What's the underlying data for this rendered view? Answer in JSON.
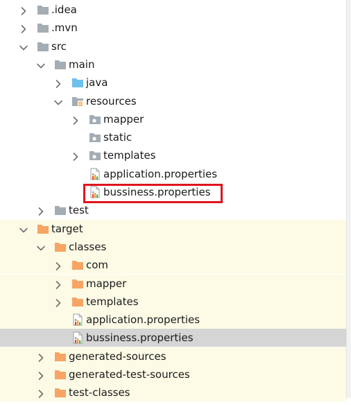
{
  "tree": {
    "nodes": [
      {
        "id": "idea",
        "label": ".idea",
        "depth": 0,
        "arrow": "right",
        "icon": "folder-gray"
      },
      {
        "id": "mvn",
        "label": ".mvn",
        "depth": 0,
        "arrow": "right",
        "icon": "folder-gray"
      },
      {
        "id": "src",
        "label": "src",
        "depth": 0,
        "arrow": "down",
        "icon": "folder-gray"
      },
      {
        "id": "main",
        "label": "main",
        "depth": 1,
        "arrow": "down",
        "icon": "folder-gray"
      },
      {
        "id": "java",
        "label": "java",
        "depth": 2,
        "arrow": "right",
        "icon": "folder-blue"
      },
      {
        "id": "resources",
        "label": "resources",
        "depth": 2,
        "arrow": "down",
        "icon": "folder-resources"
      },
      {
        "id": "mapper",
        "label": "mapper",
        "depth": 3,
        "arrow": "right",
        "icon": "folder-package"
      },
      {
        "id": "static",
        "label": "static",
        "depth": 3,
        "arrow": "none",
        "icon": "folder-package"
      },
      {
        "id": "templates",
        "label": "templates",
        "depth": 3,
        "arrow": "right",
        "icon": "folder-package"
      },
      {
        "id": "app-props-src",
        "label": "application.properties",
        "depth": 3,
        "arrow": "none",
        "icon": "properties-file"
      },
      {
        "id": "biz-props-src",
        "label": "bussiness.properties",
        "depth": 3,
        "arrow": "none",
        "icon": "properties-file"
      },
      {
        "id": "test",
        "label": "test",
        "depth": 1,
        "arrow": "right",
        "icon": "folder-gray"
      },
      {
        "id": "target",
        "label": "target",
        "depth": 0,
        "arrow": "down",
        "icon": "folder-orange",
        "excluded": true
      },
      {
        "id": "classes",
        "label": "classes",
        "depth": 1,
        "arrow": "down",
        "icon": "folder-orange",
        "excluded": true
      },
      {
        "id": "com",
        "label": "com",
        "depth": 2,
        "arrow": "right",
        "icon": "folder-orange",
        "excluded": true
      },
      {
        "id": "mapper-target",
        "label": "mapper",
        "depth": 2,
        "arrow": "right",
        "icon": "folder-orange",
        "excluded": true
      },
      {
        "id": "templates-target",
        "label": "templates",
        "depth": 2,
        "arrow": "right",
        "icon": "folder-orange",
        "excluded": true
      },
      {
        "id": "app-props-target",
        "label": "application.properties",
        "depth": 2,
        "arrow": "none",
        "icon": "properties-file",
        "excluded": true
      },
      {
        "id": "biz-props-target",
        "label": "bussiness.properties",
        "depth": 2,
        "arrow": "none",
        "icon": "properties-file",
        "excluded": true,
        "selected": true
      },
      {
        "id": "generated-sources",
        "label": "generated-sources",
        "depth": 1,
        "arrow": "right",
        "icon": "folder-orange",
        "excluded": true
      },
      {
        "id": "generated-test-sources",
        "label": "generated-test-sources",
        "depth": 1,
        "arrow": "right",
        "icon": "folder-orange",
        "excluded": true
      },
      {
        "id": "test-classes",
        "label": "test-classes",
        "depth": 1,
        "arrow": "right",
        "icon": "folder-orange",
        "excluded": true
      }
    ]
  },
  "colors": {
    "folder_gray": "#a4acb4",
    "folder_blue": "#6ec0ed",
    "folder_orange": "#f7a464",
    "arrow": "#6e6e6e",
    "highlight_border": "#e0141e",
    "excluded_bg": "#fdfbe6",
    "selected_bg": "#d5d5d5"
  }
}
